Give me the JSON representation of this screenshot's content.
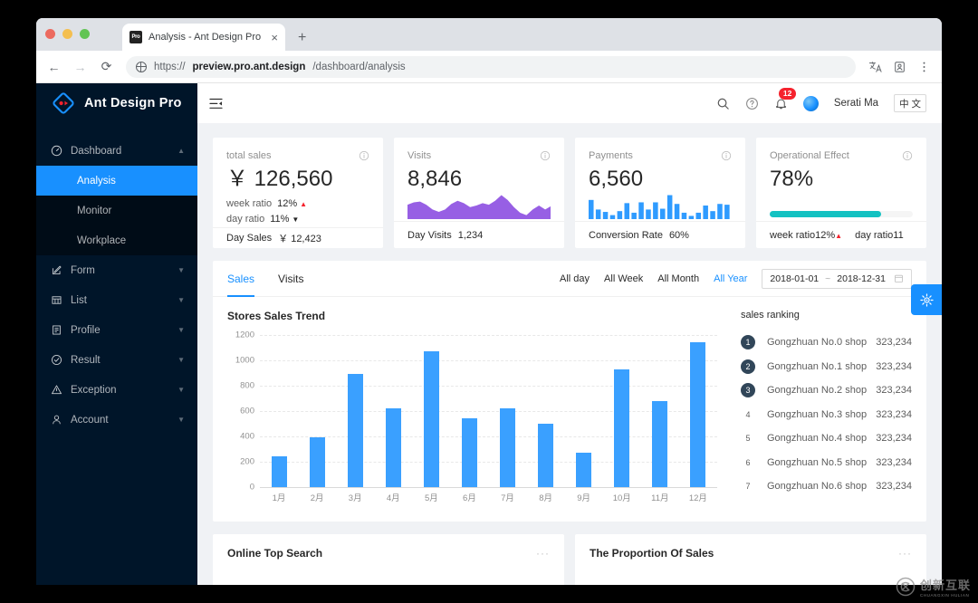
{
  "browser": {
    "tab_title": "Analysis - Ant Design Pro",
    "favicon_text": "Pro",
    "close_glyph": "×",
    "newtab_glyph": "+",
    "back_glyph": "←",
    "forward_glyph": "→",
    "reload_glyph": "⟳",
    "url_prefix": "https://",
    "url_host": "preview.pro.ant.design",
    "url_path": "/dashboard/analysis"
  },
  "sidebar": {
    "logo_text": "Ant Design Pro",
    "items": [
      {
        "label": "Dashboard",
        "icon": "dashboard-icon",
        "expanded": true,
        "chevron": "▲"
      },
      {
        "label": "Form",
        "icon": "form-icon",
        "expanded": false,
        "chevron": "▼"
      },
      {
        "label": "List",
        "icon": "list-icon",
        "expanded": false,
        "chevron": "▼"
      },
      {
        "label": "Profile",
        "icon": "profile-icon",
        "expanded": false,
        "chevron": "▼"
      },
      {
        "label": "Result",
        "icon": "result-icon",
        "expanded": false,
        "chevron": "▼"
      },
      {
        "label": "Exception",
        "icon": "exception-icon",
        "expanded": false,
        "chevron": "▼"
      },
      {
        "label": "Account",
        "icon": "account-icon",
        "expanded": false,
        "chevron": "▼"
      }
    ],
    "dashboard_children": [
      {
        "label": "Analysis",
        "active": true
      },
      {
        "label": "Monitor",
        "active": false
      },
      {
        "label": "Workplace",
        "active": false
      }
    ]
  },
  "header": {
    "fold_icon": "menu-fold-icon",
    "search_icon": "search-icon",
    "help_icon": "question-circle-icon",
    "bell_icon": "bell-icon",
    "notification_count": "12",
    "user_name": "Serati Ma",
    "lang_label": "中 文"
  },
  "kpis": [
    {
      "title": "total sales",
      "value": "￥ 126,560",
      "week_label": "week ratio",
      "week_value": "12%",
      "week_dir": "up",
      "day_label": "day ratio",
      "day_value": "11%",
      "day_dir": "down",
      "footer_label": "Day Sales",
      "footer_value": "￥ 12,423",
      "visual": "none"
    },
    {
      "title": "Visits",
      "value": "8,846",
      "footer_label": "Day Visits",
      "footer_value": "1,234",
      "visual": "area",
      "accent": "#975FE4"
    },
    {
      "title": "Payments",
      "value": "6,560",
      "footer_label": "Conversion Rate",
      "footer_value": "60%",
      "visual": "minibars",
      "accent": "#2f9bff"
    },
    {
      "title": "Operational Effect",
      "value": "78%",
      "week_label": "week ratio",
      "week_value": "12%",
      "week_dir": "up",
      "day_label": "day ratio",
      "day_value": "11",
      "day_dir": "down",
      "visual": "progress",
      "progress_percent": 78,
      "accent": "#13c2c2"
    }
  ],
  "panel": {
    "tabs": [
      {
        "label": "Sales",
        "active": true
      },
      {
        "label": "Visits",
        "active": false
      }
    ],
    "ranges": [
      {
        "label": "All day",
        "active": false
      },
      {
        "label": "All Week",
        "active": false
      },
      {
        "label": "All Month",
        "active": false
      },
      {
        "label": "All Year",
        "active": true
      }
    ],
    "date_start": "2018-01-01",
    "date_sep": "~",
    "date_end": "2018-12-31",
    "calendar_icon": "calendar-icon",
    "chart_title": "Stores Sales Trend",
    "ranking_title": "sales ranking"
  },
  "chart_data": {
    "type": "bar",
    "title": "Stores Sales Trend",
    "categories": [
      "1月",
      "2月",
      "3月",
      "4月",
      "5月",
      "6月",
      "7月",
      "8月",
      "9月",
      "10月",
      "11月",
      "12月"
    ],
    "values": [
      240,
      395,
      890,
      620,
      1070,
      540,
      620,
      500,
      270,
      930,
      680,
      1140
    ],
    "xlabel": "",
    "ylabel": "",
    "ylim": [
      0,
      1200
    ],
    "yticks": [
      0,
      200,
      400,
      600,
      800,
      1000,
      1200
    ],
    "grid": true,
    "legend": "none",
    "color": "#3aa0ff"
  },
  "ranking": [
    {
      "rank": "1",
      "name": "Gongzhuan No.0 shop",
      "value": "323,234"
    },
    {
      "rank": "2",
      "name": "Gongzhuan No.1 shop",
      "value": "323,234"
    },
    {
      "rank": "3",
      "name": "Gongzhuan No.2 shop",
      "value": "323,234"
    },
    {
      "rank": "4",
      "name": "Gongzhuan No.3 shop",
      "value": "323,234"
    },
    {
      "rank": "5",
      "name": "Gongzhuan No.4 shop",
      "value": "323,234"
    },
    {
      "rank": "6",
      "name": "Gongzhuan No.5 shop",
      "value": "323,234"
    },
    {
      "rank": "7",
      "name": "Gongzhuan No.6 shop",
      "value": "323,234"
    }
  ],
  "bottom_cards": [
    {
      "title": "Online Top Search",
      "more": "···"
    },
    {
      "title": "The Proportion Of Sales",
      "more": "···"
    }
  ],
  "floating": {
    "gear_icon": "setting-icon"
  },
  "watermark": {
    "cn": "创新互联",
    "en": "CHUANGXIN HULIAN"
  }
}
